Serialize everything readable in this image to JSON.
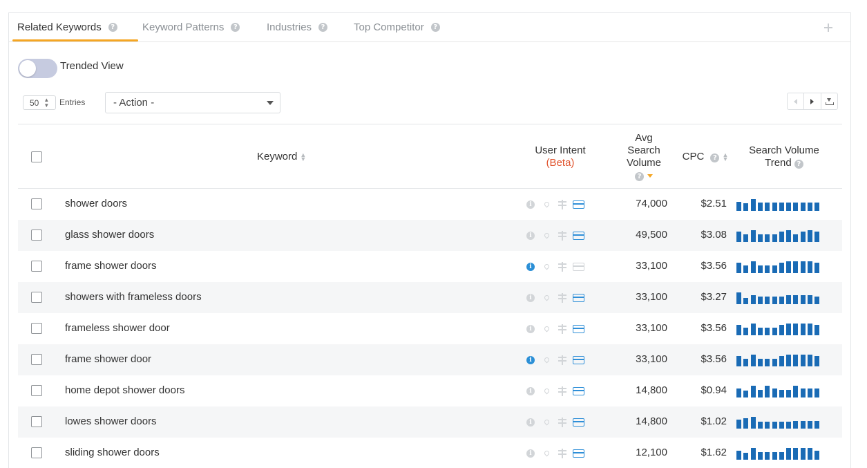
{
  "tabs": [
    {
      "label": "Related Keywords",
      "active": true
    },
    {
      "label": "Keyword Patterns",
      "active": false
    },
    {
      "label": "Industries",
      "active": false
    },
    {
      "label": "Top Competitor",
      "active": false
    }
  ],
  "help_glyph": "?",
  "toggle": {
    "label": "Trended View",
    "on": false
  },
  "entries": {
    "value": "50",
    "label": "Entries"
  },
  "action": {
    "selected": "- Action -"
  },
  "colors": {
    "accent": "#f5a623",
    "beta": "#e0522c",
    "bar": "#1a6bb5",
    "info_active": "#2b8fd6",
    "icon_muted": "#d2d5d8",
    "card_active": "#2f8fd8",
    "row_alt": "#f5f6f7"
  },
  "columns": {
    "keyword": "Keyword",
    "user_intent": "User Intent",
    "beta": "(Beta)",
    "volume_1": "Avg",
    "volume_2": "Search",
    "volume_3": "Volume",
    "cpc": "CPC",
    "trend_1": "Search Volume",
    "trend_2": "Trend"
  },
  "intent_icons": [
    "info-icon",
    "pin-icon",
    "signpost-icon",
    "credit-card-icon"
  ],
  "rows": [
    {
      "keyword": "shower doors",
      "volume": "74,000",
      "cpc": "$2.51",
      "info": false,
      "card": true,
      "trend": [
        0.78,
        0.65,
        1.0,
        0.72,
        0.72,
        0.72,
        0.72,
        0.72,
        0.72,
        0.72,
        0.72,
        0.72
      ]
    },
    {
      "keyword": "glass shower doors",
      "volume": "49,500",
      "cpc": "$3.08",
      "info": false,
      "card": true,
      "trend": [
        0.88,
        0.65,
        1.0,
        0.65,
        0.65,
        0.65,
        0.88,
        1.0,
        0.65,
        0.88,
        1.0,
        0.88
      ]
    },
    {
      "keyword": "frame shower doors",
      "volume": "33,100",
      "cpc": "$3.56",
      "info": true,
      "card": false,
      "trend": [
        0.88,
        0.65,
        1.0,
        0.65,
        0.65,
        0.65,
        0.88,
        1.0,
        1.0,
        1.0,
        1.0,
        0.88
      ]
    },
    {
      "keyword": "showers with frameless doors",
      "volume": "33,100",
      "cpc": "$3.27",
      "info": false,
      "card": true,
      "trend": [
        1.0,
        0.55,
        0.78,
        0.65,
        0.65,
        0.65,
        0.65,
        0.78,
        0.78,
        0.78,
        0.78,
        0.65
      ]
    },
    {
      "keyword": "frameless shower door",
      "volume": "33,100",
      "cpc": "$3.56",
      "info": false,
      "card": true,
      "trend": [
        0.88,
        0.65,
        1.0,
        0.65,
        0.65,
        0.65,
        0.88,
        1.0,
        1.0,
        1.0,
        1.0,
        0.88
      ]
    },
    {
      "keyword": "frame shower door",
      "volume": "33,100",
      "cpc": "$3.56",
      "info": true,
      "card": true,
      "trend": [
        0.88,
        0.65,
        1.0,
        0.65,
        0.65,
        0.65,
        0.88,
        1.0,
        1.0,
        1.0,
        1.0,
        0.88
      ]
    },
    {
      "keyword": "home depot shower doors",
      "volume": "14,800",
      "cpc": "$0.94",
      "info": false,
      "card": true,
      "trend": [
        0.78,
        0.6,
        1.0,
        0.65,
        1.0,
        0.78,
        0.65,
        0.65,
        1.0,
        0.78,
        0.78,
        0.78
      ]
    },
    {
      "keyword": "lowes shower doors",
      "volume": "14,800",
      "cpc": "$1.02",
      "info": false,
      "card": true,
      "trend": [
        0.78,
        0.88,
        1.0,
        0.6,
        0.6,
        0.6,
        0.6,
        0.6,
        0.65,
        0.65,
        0.65,
        0.65
      ]
    },
    {
      "keyword": "sliding shower doors",
      "volume": "12,100",
      "cpc": "$1.62",
      "info": false,
      "card": true,
      "trend": [
        0.78,
        0.6,
        1.0,
        0.65,
        0.65,
        0.65,
        0.65,
        1.0,
        1.0,
        1.0,
        1.0,
        0.78
      ]
    }
  ]
}
